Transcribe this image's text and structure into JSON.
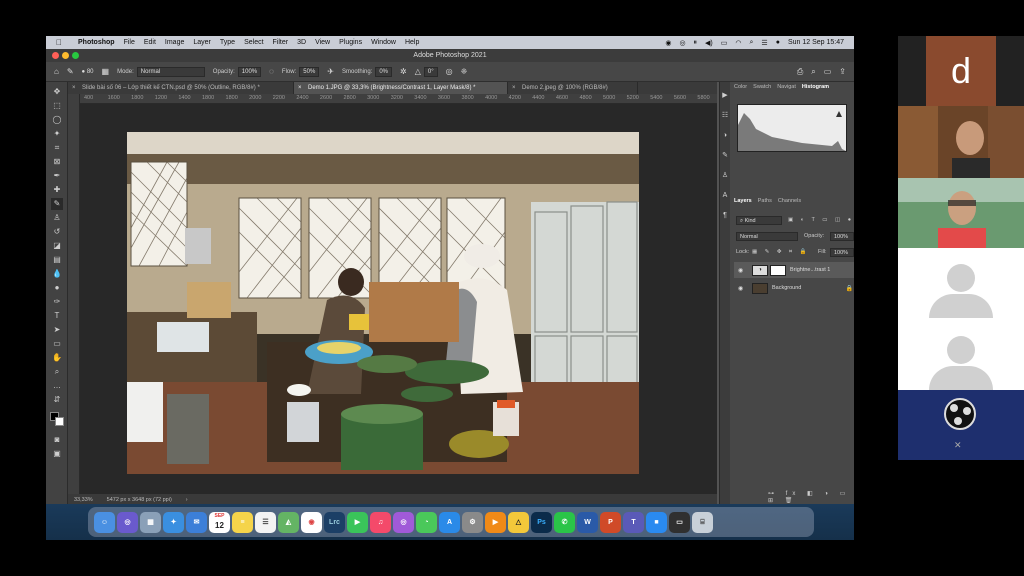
{
  "menubar": {
    "apple": "",
    "app": "Photoshop",
    "items": [
      "File",
      "Edit",
      "Image",
      "Layer",
      "Type",
      "Select",
      "Filter",
      "3D",
      "View",
      "Plugins",
      "Window",
      "Help"
    ],
    "datetime": "Sun 12 Sep  15:47"
  },
  "window": {
    "title": "Adobe Photoshop 2021"
  },
  "options": {
    "brush_size": "80",
    "mode_label": "Mode:",
    "mode_value": "Normal",
    "opacity_label": "Opacity:",
    "opacity_value": "100%",
    "flow_label": "Flow:",
    "flow_value": "50%",
    "smoothing_label": "Smoothing:",
    "smoothing_value": "0%",
    "angle_value": "0°"
  },
  "tabs": [
    {
      "label": "Slide bài số 06 – Lớp thiết kế CTN.psd @ 50% (Outline, RGB/8#) *"
    },
    {
      "label": "Demo 1.JPG @ 33,3% (Brightness/Contrast 1, Layer Mask/8) *"
    },
    {
      "label": "Demo 2.jpeg @ 100% (RGB/8#)"
    }
  ],
  "ruler": [
    "400",
    "1600",
    "1800",
    "1200",
    "1400",
    "1800",
    "1800",
    "2000",
    "2200",
    "2400",
    "2600",
    "2800",
    "3000",
    "3200",
    "3400",
    "3600",
    "3800",
    "4000",
    "4200",
    "4400",
    "4600",
    "4800",
    "5000",
    "5200",
    "5400",
    "5600",
    "5800"
  ],
  "status": {
    "zoom": "33,33%",
    "dimensions": "5472 px x 3648 px (72 ppi)",
    "arrow": "›"
  },
  "panel_top": {
    "tabs": [
      "Color",
      "Swatch",
      "Navigat",
      "Histogram"
    ]
  },
  "panel_layers": {
    "tabs": [
      "Layers",
      "Paths",
      "Channels"
    ],
    "kind": "Kind",
    "blend": "Normal",
    "opacity_label": "Opacity:",
    "opacity_value": "100%",
    "lock_label": "Lock:",
    "fill_label": "Fill:",
    "fill_value": "100%",
    "layers": [
      {
        "name": "Brightne...trast 1"
      },
      {
        "name": "Background"
      }
    ]
  },
  "dock": {
    "calendar_month": "SEP",
    "calendar_day": "12",
    "icons": [
      "finder",
      "launchpad",
      "launchpad-grid",
      "safari",
      "mail",
      "calendar",
      "notes",
      "reminders",
      "maps",
      "chrome",
      "lightroom",
      "facetime",
      "music",
      "podcasts",
      "messages",
      "app-store",
      "settings",
      "vlc",
      "vectorize",
      "photoshop",
      "whatsapp",
      "word",
      "powerpoint",
      "teams",
      "zoom",
      "screen",
      "trash"
    ],
    "lrc": "Lrc",
    "ps": "Ps"
  },
  "participants": {
    "first_initial": "d"
  },
  "colors": {
    "ps_bg": "#535353",
    "canvas": "#282828",
    "menubar": "#c9cdd6",
    "obs_tile": "#1e2f6e",
    "avatar_d": "#8a4a2e"
  }
}
